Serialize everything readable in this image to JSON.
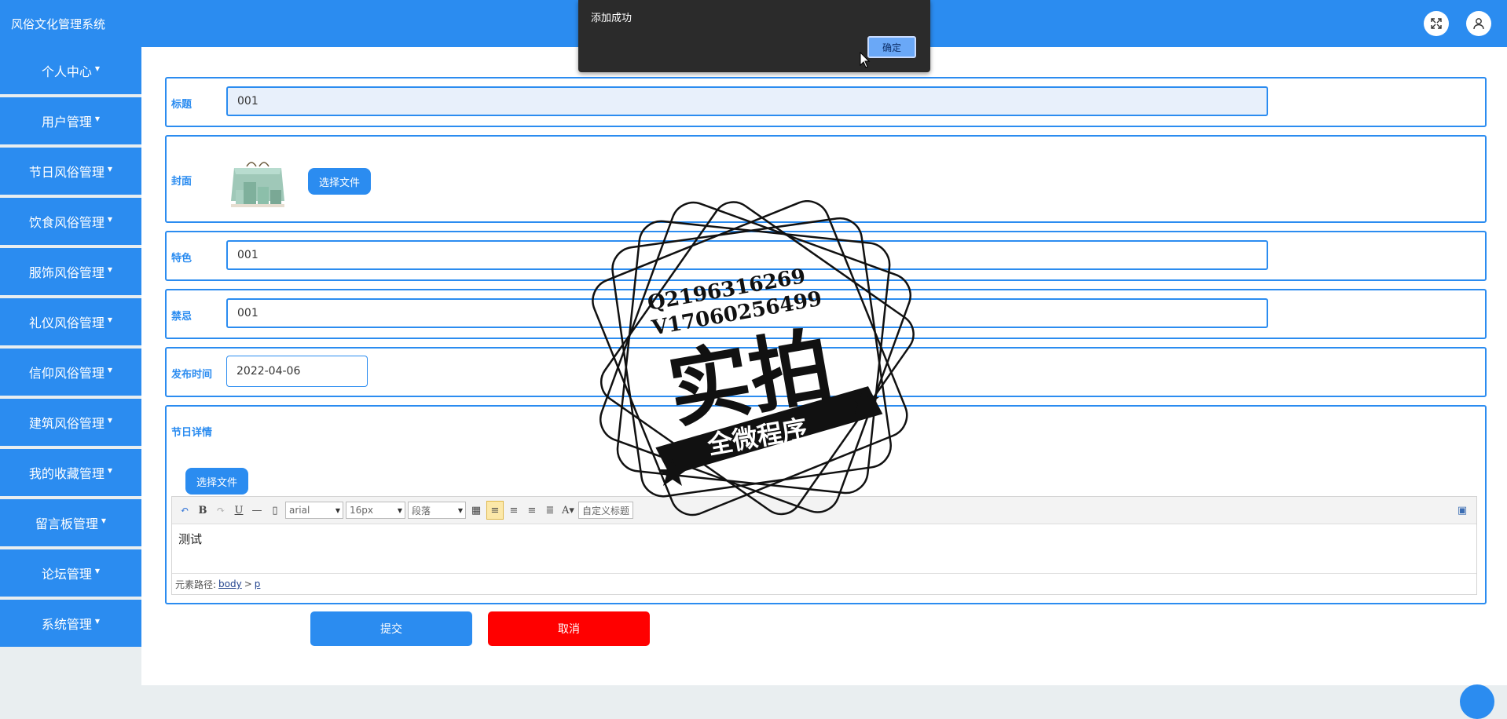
{
  "app": {
    "title": "风俗文化管理系统"
  },
  "header": {
    "icons": [
      "fullscreen-icon",
      "user-icon"
    ]
  },
  "sidebar": {
    "items": [
      {
        "label": "个人中心"
      },
      {
        "label": "用户管理"
      },
      {
        "label": "节日风俗管理"
      },
      {
        "label": "饮食风俗管理"
      },
      {
        "label": "服饰风俗管理"
      },
      {
        "label": "礼仪风俗管理"
      },
      {
        "label": "信仰风俗管理"
      },
      {
        "label": "建筑风俗管理"
      },
      {
        "label": "我的收藏管理"
      },
      {
        "label": "留言板管理"
      },
      {
        "label": "论坛管理"
      },
      {
        "label": "系统管理"
      }
    ]
  },
  "form": {
    "title": {
      "label": "标题",
      "value": "001"
    },
    "cover": {
      "label": "封面",
      "button": "选择文件"
    },
    "feature": {
      "label": "特色",
      "value": "001"
    },
    "taboo": {
      "label": "禁忌",
      "value": "001"
    },
    "publish_time": {
      "label": "发布时间",
      "value": "2022-04-06"
    },
    "details": {
      "label": "节日详情",
      "button": "选择文件",
      "toolbar": {
        "font_family": "arial",
        "font_size": "16px",
        "paragraph": "段落",
        "custom_title": "自定义标题"
      },
      "content": "测试",
      "path_label": "元素路径:",
      "path_body": "body",
      "path_sep": ">",
      "path_p": "p"
    },
    "submit": "提交",
    "cancel": "取消"
  },
  "dialog": {
    "message": "添加成功",
    "ok": "确定"
  },
  "watermark": {
    "line1": "Q2196316269",
    "line2": "V17060256499",
    "big": "实拍",
    "ribbon": "全微程序"
  }
}
